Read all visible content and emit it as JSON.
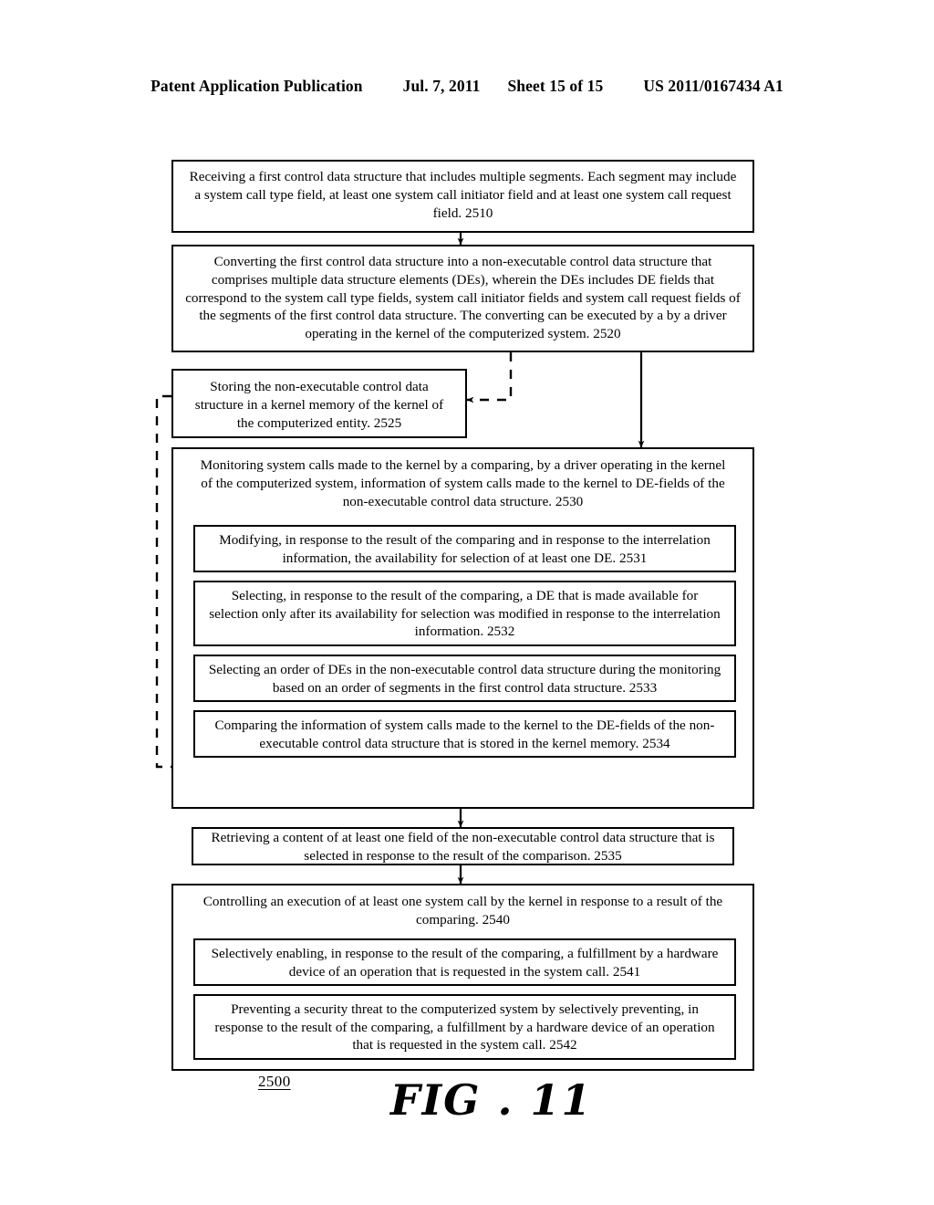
{
  "header": {
    "publication": "Patent Application Publication",
    "date": "Jul. 7, 2011",
    "sheet": "Sheet 15 of 15",
    "number": "US 2011/0167434 A1"
  },
  "figure": {
    "reference_number": "2500",
    "caption": "FIG . 11"
  },
  "flowchart": {
    "steps": [
      {
        "id": "2510",
        "name": "receiving-step",
        "text": "Receiving a first control data structure that includes multiple segments.  Each segment may include a system call type field, at least one system call initiator field and at least one system call request field. 2510"
      },
      {
        "id": "2520",
        "name": "converting-step",
        "text": "Converting the first control data structure into a non-executable control data structure that comprises multiple data structure elements (DEs), wherein the DEs includes DE fields that correspond to the system call type fields, system call initiator fields and system call request fields of the segments of the first control data structure. The converting can be executed by a by a driver operating in the kernel of the computerized system. 2520"
      },
      {
        "id": "2525",
        "name": "storing-step",
        "text": "Storing the non-executable control data structure in a kernel memory of the kernel of the computerized entity. 2525"
      },
      {
        "id": "2530",
        "name": "monitoring-step",
        "text": "Monitoring system calls made to the kernel by a comparing, by a driver operating in the kernel of the computerized system, information of system calls made to the kernel to DE-fields of the non-executable control data structure. 2530",
        "substeps": [
          {
            "id": "2531",
            "name": "modifying-substep",
            "text": "Modifying, in response to the result of the comparing and in response to the interrelation information, the availability for selection of at least one DE. 2531"
          },
          {
            "id": "2532",
            "name": "selecting-de-substep",
            "text": "Selecting, in response to the result of the comparing, a DE that is made available for selection only after its availability for selection was modified in response to the interrelation information. 2532"
          },
          {
            "id": "2533",
            "name": "selecting-order-substep",
            "text": "Selecting an order of DEs in the non-executable control data structure during the monitoring based on an order of segments in the first control data structure. 2533"
          },
          {
            "id": "2534",
            "name": "comparing-substep",
            "text": "Comparing the information of system calls made to the kernel to the DE-fields of the non-executable control data structure that is stored in the kernel memory. 2534"
          }
        ]
      },
      {
        "id": "2535",
        "name": "retrieving-step",
        "text": "Retrieving a content of at least one field of the non-executable control data structure that is selected in response to the result of the comparison. 2535"
      },
      {
        "id": "2540",
        "name": "controlling-step",
        "text": "Controlling an execution of at least one system call by the kernel in response to a result of the comparing. 2540",
        "substeps": [
          {
            "id": "2541",
            "name": "enabling-substep",
            "text": "Selectively enabling, in response to the result of the comparing, a fulfillment by a hardware device of an operation that is requested in the system call. 2541"
          },
          {
            "id": "2542",
            "name": "preventing-substep",
            "text": "Preventing a security threat to the computerized system by selectively preventing, in response to the result of the comparing, a fulfillment by a hardware device of an operation that is requested in the system call. 2542"
          }
        ]
      }
    ],
    "connectors": [
      {
        "name": "arrow-2510-to-2520",
        "style": "solid"
      },
      {
        "name": "arrow-2520-to-2525",
        "style": "dashed"
      },
      {
        "name": "arrow-2520-to-2530",
        "style": "solid"
      },
      {
        "name": "arrow-2525-to-2534",
        "style": "dashed"
      },
      {
        "name": "arrow-2530-to-2535",
        "style": "solid"
      },
      {
        "name": "arrow-2535-to-2540",
        "style": "solid"
      }
    ],
    "colors": {
      "line": "#000000",
      "background": "#ffffff"
    }
  }
}
